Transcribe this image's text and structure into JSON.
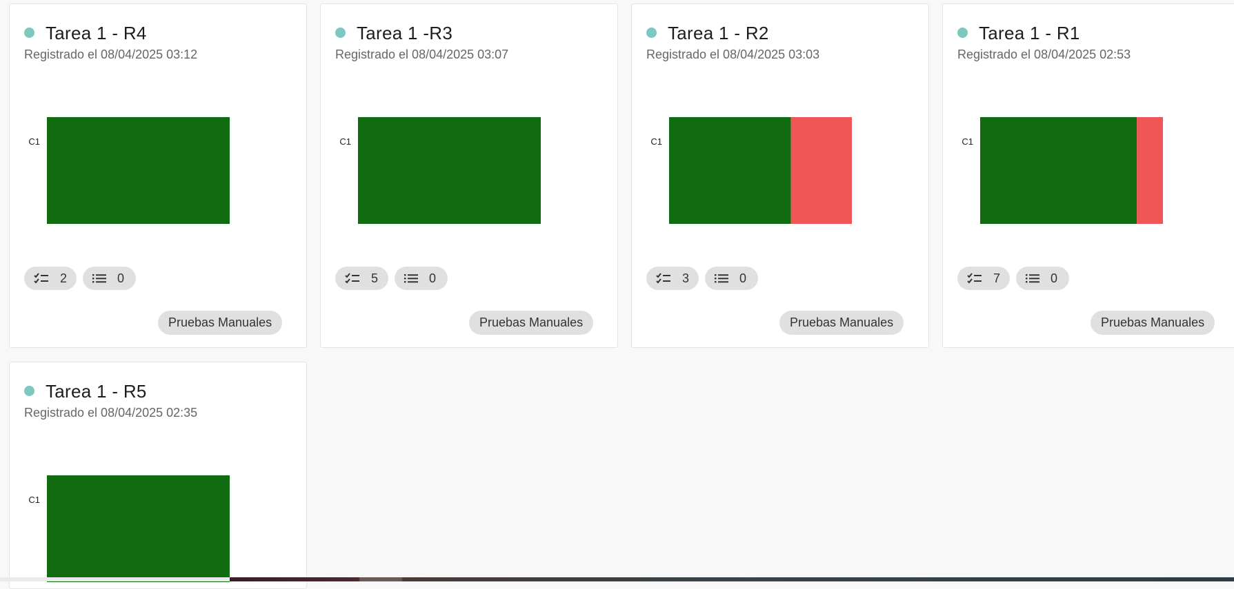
{
  "colors": {
    "dot": "#7ec8c0",
    "pass": "#116c11",
    "fail": "#ef5656"
  },
  "icons": {
    "completed": "checklist-icon",
    "items": "list-icon"
  },
  "cards": [
    {
      "title": "Tarea 1 - R4",
      "subtitle": "Registrado el 08/04/2025 03:12",
      "chart_label": "C1",
      "pass_fraction": 1.0,
      "fail_fraction": 0.0,
      "completed_count": "2",
      "items_count": "0",
      "tag": "Pruebas Manuales"
    },
    {
      "title": "Tarea 1 -R3",
      "subtitle": "Registrado el 08/04/2025 03:07",
      "chart_label": "C1",
      "pass_fraction": 1.0,
      "fail_fraction": 0.0,
      "completed_count": "5",
      "items_count": "0",
      "tag": "Pruebas Manuales"
    },
    {
      "title": "Tarea 1 - R2",
      "subtitle": "Registrado el 08/04/2025 03:03",
      "chart_label": "C1",
      "pass_fraction": 0.6667,
      "fail_fraction": 0.3333,
      "completed_count": "3",
      "items_count": "0",
      "tag": "Pruebas Manuales"
    },
    {
      "title": "Tarea 1 - R1",
      "subtitle": "Registrado el 08/04/2025 02:53",
      "chart_label": "C1",
      "pass_fraction": 0.8571,
      "fail_fraction": 0.1429,
      "completed_count": "7",
      "items_count": "0",
      "tag": "Pruebas Manuales"
    },
    {
      "title": "Tarea 1 - R5",
      "subtitle": "Registrado el 08/04/2025 02:35",
      "chart_label": "C1",
      "pass_fraction": 1.0,
      "fail_fraction": 0.0
    }
  ]
}
